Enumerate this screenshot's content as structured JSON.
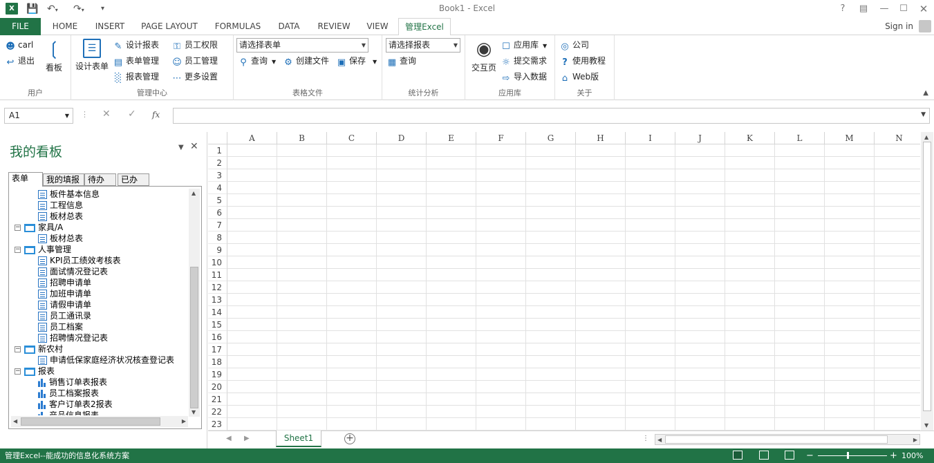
{
  "window": {
    "title": "Book1 - Excel",
    "logo": "X",
    "icons": [
      "save-icon",
      "undo-icon",
      "redo-icon",
      "customize-icon",
      "help-icon",
      "ribbon-display-icon",
      "minimize-icon",
      "maximize-icon",
      "close-icon"
    ]
  },
  "tabs": {
    "file": "FILE",
    "items": [
      "HOME",
      "INSERT",
      "PAGE LAYOUT",
      "FORMULAS",
      "DATA",
      "REVIEW",
      "VIEW",
      "管理Excel"
    ],
    "active": "管理Excel",
    "signin": "Sign in"
  },
  "ribbon": {
    "user": {
      "label": "用户",
      "user_name": "carl",
      "logout": "退出",
      "board": "看板"
    },
    "admin": {
      "label": "管理中心",
      "design_table": "设计表单",
      "design_report": "设计报表",
      "table_mgmt": "表单管理",
      "report_mgmt": "报表管理",
      "staff_perm": "员工权限",
      "staff_mgmt": "员工管理",
      "more_settings": "更多设置"
    },
    "files": {
      "label": "表格文件",
      "select_table": "请选择表单",
      "query": "查询",
      "create_file": "创建文件",
      "save": "保存"
    },
    "stats": {
      "label": "统计分析",
      "select_report": "请选择报表",
      "query": "查询"
    },
    "apps": {
      "label": "应用库",
      "exchange": "交互页",
      "app_store": "应用库",
      "submit_req": "提交需求",
      "import_data": "导入数据"
    },
    "about": {
      "label": "关于",
      "company": "公司",
      "tutorial": "使用教程",
      "web": "Web版"
    }
  },
  "formula_bar": {
    "name_box": "A1",
    "fx": "fx",
    "value": ""
  },
  "panel": {
    "title": "我的看板",
    "tabs": [
      "表单",
      "我的填报",
      "待办",
      "已办"
    ],
    "active_tab": "表单",
    "tree": [
      {
        "label": "板件基本信息",
        "type": "doc",
        "level": 2
      },
      {
        "label": "工程信息",
        "type": "doc",
        "level": 2
      },
      {
        "label": "板材总表",
        "type": "doc",
        "level": 2
      },
      {
        "label": "家具/A",
        "type": "folder",
        "level": 1
      },
      {
        "label": "板材总表",
        "type": "doc",
        "level": 2
      },
      {
        "label": "人事管理",
        "type": "folder",
        "level": 1
      },
      {
        "label": "KPI员工绩效考核表",
        "type": "doc",
        "level": 2
      },
      {
        "label": "面试情况登记表",
        "type": "doc",
        "level": 2
      },
      {
        "label": "招聘申请单",
        "type": "doc",
        "level": 2
      },
      {
        "label": "加班申请单",
        "type": "doc",
        "level": 2
      },
      {
        "label": "请假申请单",
        "type": "doc",
        "level": 2
      },
      {
        "label": "员工通讯录",
        "type": "doc",
        "level": 2
      },
      {
        "label": "员工档案",
        "type": "doc",
        "level": 2
      },
      {
        "label": "招聘情况登记表",
        "type": "doc",
        "level": 2
      },
      {
        "label": "新农村",
        "type": "folder",
        "level": 1
      },
      {
        "label": "申请低保家庭经济状况核查登记表",
        "type": "doc",
        "level": 2
      },
      {
        "label": "报表",
        "type": "folder",
        "level": 1
      },
      {
        "label": "销售订单表报表",
        "type": "chart",
        "level": 2
      },
      {
        "label": "员工档案报表",
        "type": "chart",
        "level": 2
      },
      {
        "label": "客户订单表2报表",
        "type": "chart",
        "level": 2
      },
      {
        "label": "产品信息报表",
        "type": "chart",
        "level": 2
      }
    ]
  },
  "grid": {
    "columns": [
      "A",
      "B",
      "C",
      "D",
      "E",
      "F",
      "G",
      "H",
      "I",
      "J",
      "K",
      "L",
      "M",
      "N"
    ],
    "rows": [
      "1",
      "2",
      "3",
      "4",
      "5",
      "6",
      "7",
      "8",
      "9",
      "10",
      "11",
      "12",
      "13",
      "14",
      "15",
      "16",
      "17",
      "18",
      "19",
      "20",
      "21",
      "22",
      "23"
    ]
  },
  "sheets": {
    "items": [
      "Sheet1"
    ],
    "active": "Sheet1"
  },
  "status": {
    "message": "管理Excel--能成功的信息化系统方案",
    "zoom": "100%",
    "zoom_minus": "−",
    "zoom_plus": "+"
  },
  "colors": {
    "accent": "#217346",
    "icon_blue": "#1e6fb8"
  }
}
